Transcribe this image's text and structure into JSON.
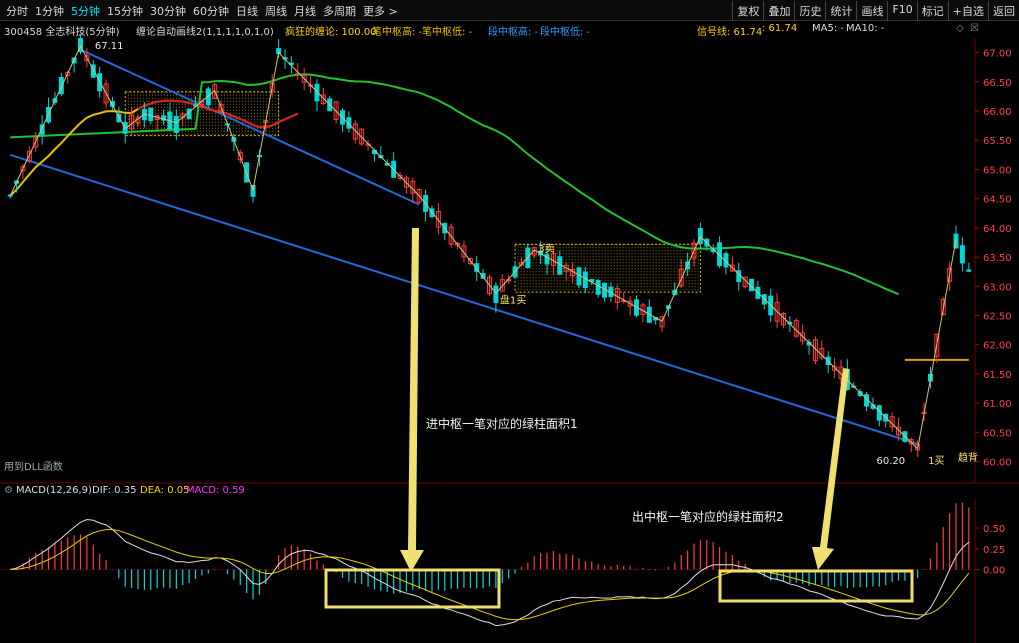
{
  "toolbar": {
    "periods": [
      "分时",
      "1分钟",
      "5分钟",
      "15分钟",
      "30分钟",
      "60分钟",
      "日线",
      "周线",
      "月线",
      "多周期",
      "更多 >"
    ],
    "active_period": "5分钟",
    "actions": [
      "复权",
      "叠加",
      "历史",
      "统计",
      "画线",
      "F10",
      "标记",
      "+自选",
      "返回"
    ]
  },
  "info": {
    "stock": "300458 全志科技(5分钟)",
    "indicator": "缠论自动画线2(1,1,1,1,0,1,0)",
    "crazy": "疯狂的缠论: 100.00",
    "bi_high": "笔中枢高: -",
    "bi_low": "笔中枢低: -",
    "duan_high": "段中枢高: -",
    "duan_low": "段中枢低: -",
    "signal": "信号线: 61.74",
    "signal2": ": 61.74",
    "ma5": "MA5: -",
    "ma10": "MA10: -"
  },
  "dll_note": "用到DLL函数",
  "macd_info": {
    "name": "MACD(12,26,9)",
    "dif": "DIF: 0.35",
    "dea": "DEA: 0.05",
    "macd": "MACD: 0.59"
  },
  "colors": {
    "up": "#ff3b3b",
    "down": "#00d7d7",
    "trendline": "#1f6ad8",
    "long_ma": "#22c12e",
    "short_ma": "#e6c200",
    "bi_line": "#d6c27a",
    "annotation": "#ffe066",
    "dif": "#e0e0e0",
    "dea": "#e6d200"
  },
  "chart_data": [
    {
      "type": "candlestick",
      "title": "",
      "ylim": [
        59.65,
        67.25
      ],
      "y_ticks": [
        "67.00",
        "66.50",
        "66.00",
        "65.50",
        "65.00",
        "64.50",
        "64.00",
        "63.50",
        "63.00",
        "62.50",
        "62.00",
        "61.50",
        "61.00",
        "60.50",
        "60.00"
      ],
      "candle_count": 151,
      "key_prices": {
        "high": 67.11,
        "low": 60.2,
        "signal": 61.74
      },
      "bi_points": [
        [
          0,
          64.55
        ],
        [
          11,
          67.11
        ],
        [
          18,
          65.7
        ],
        [
          21,
          65.95
        ],
        [
          26,
          65.8
        ],
        [
          32,
          66.35
        ],
        [
          38,
          64.65
        ],
        [
          42,
          67.0
        ],
        [
          64,
          64.55
        ],
        [
          76,
          62.88
        ],
        [
          82,
          63.62
        ],
        [
          102,
          62.4
        ],
        [
          108,
          63.85
        ],
        [
          142,
          60.22
        ],
        [
          148,
          63.8
        ]
      ],
      "zhongshu": [
        {
          "from": 18,
          "to": 42,
          "low": 65.58,
          "high": 66.33
        },
        {
          "from": 79,
          "to": 108,
          "low": 62.9,
          "high": 63.72
        }
      ],
      "labels": [
        {
          "text": "67.11"
        },
        {
          "text": "3卖"
        },
        {
          "text": "盘1买"
        },
        {
          "text": "60.20"
        },
        {
          "text": "1买"
        },
        {
          "text": "趋背"
        }
      ]
    },
    {
      "type": "bar",
      "title": "MACD(12,26,9)",
      "ylim": [
        -0.85,
        0.85
      ],
      "y_ticks": [
        "0.50",
        "0.25",
        "0.00"
      ],
      "last": {
        "dif": 0.35,
        "dea": 0.05,
        "macd": 0.59
      },
      "boxes": [
        "进中枢一笔对应的绿柱面积1",
        "出中枢一笔对应的绿柱面积2"
      ]
    }
  ],
  "annotations": {
    "area1": "进中枢一笔对应的绿柱面积1",
    "area2": "出中枢一笔对应的绿柱面积2"
  }
}
